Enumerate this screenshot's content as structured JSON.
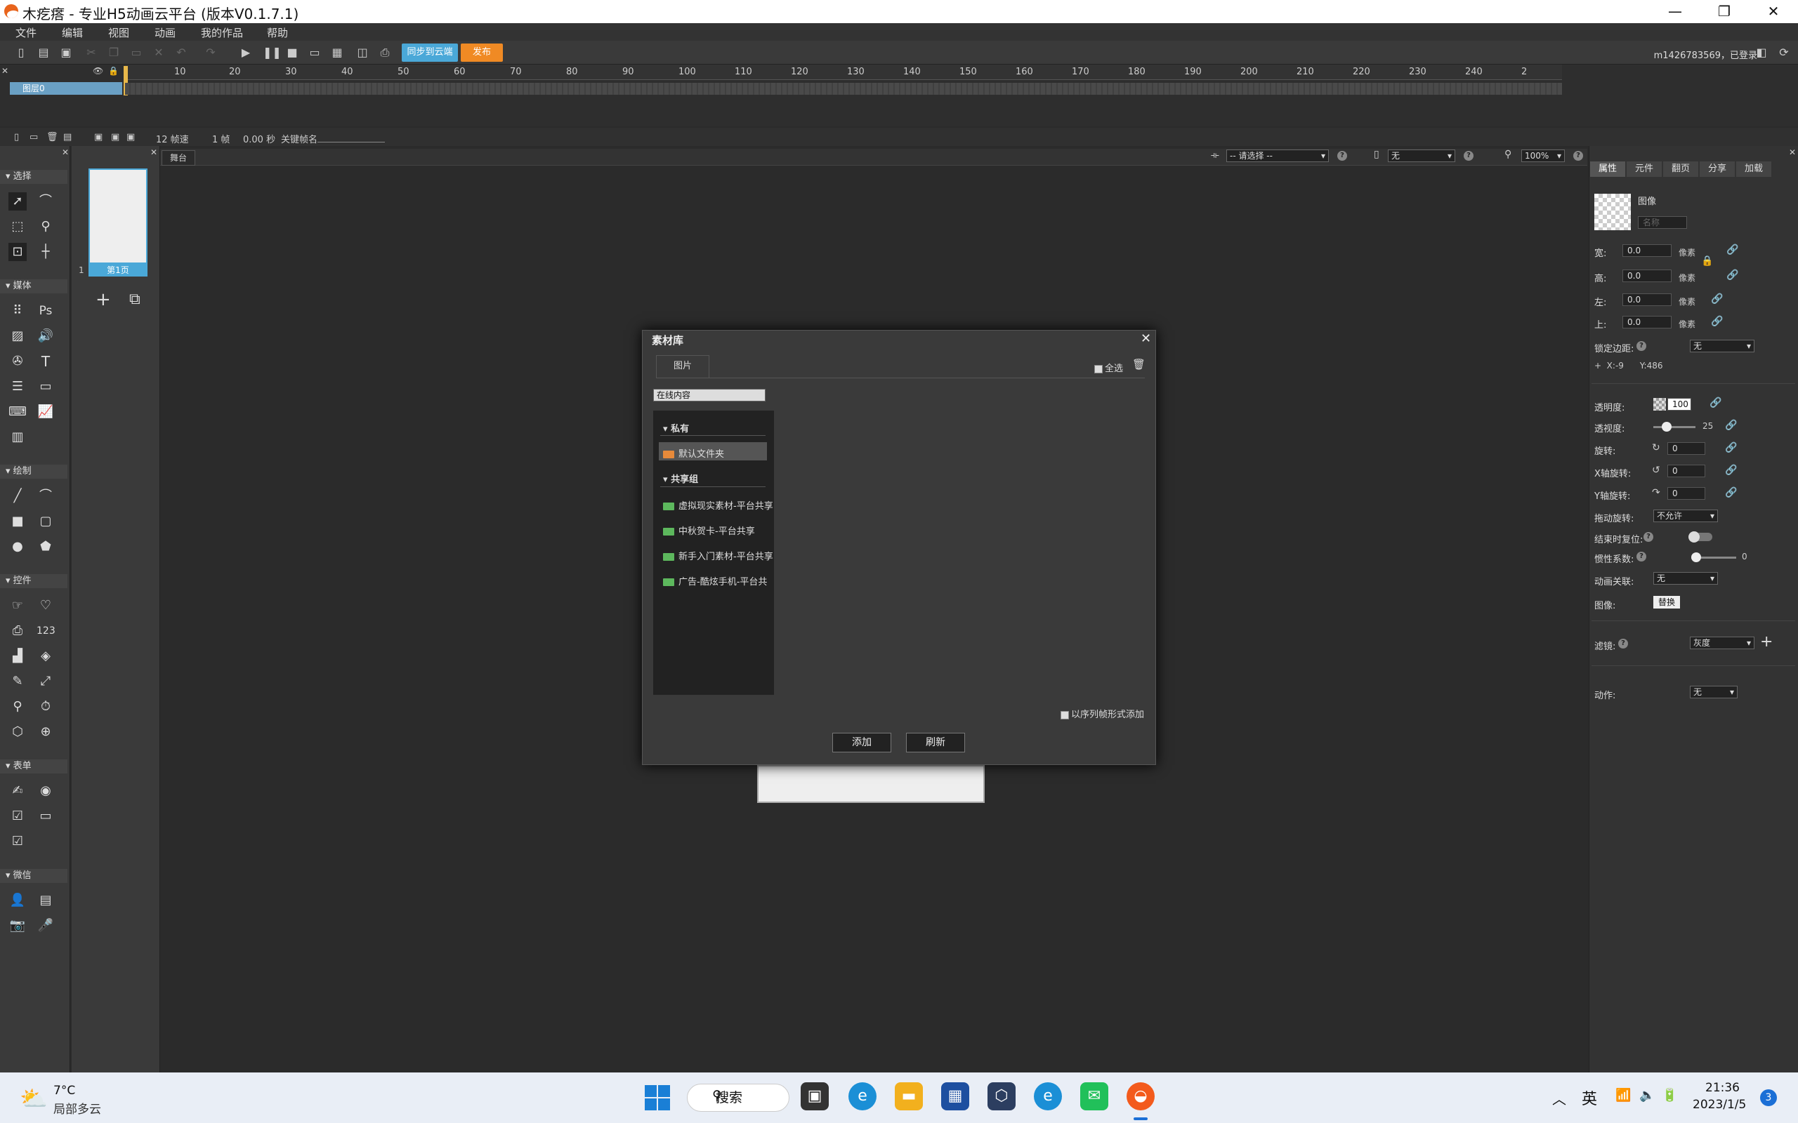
{
  "window": {
    "title": "木疙瘩 - 专业H5动画云平台 (版本V0.1.7.1)",
    "minimize": "—",
    "maximize": "❐",
    "close": "✕"
  },
  "menu": [
    "文件",
    "编辑",
    "视图",
    "动画",
    "我的作品",
    "帮助"
  ],
  "toolbar": {
    "sync_label": "同步到云端",
    "publish_label": "发布",
    "user": "m1426783569，已登录"
  },
  "timeline": {
    "ruler": [
      "10",
      "20",
      "30",
      "40",
      "50",
      "60",
      "70",
      "80",
      "90",
      "100",
      "110",
      "120",
      "130",
      "140",
      "150",
      "160",
      "170",
      "180",
      "190",
      "200",
      "210",
      "220",
      "230",
      "240",
      "2"
    ],
    "layer_name": "图层0",
    "fps": "12 帧速",
    "frame": "1 帧",
    "seconds": "0.00 秒",
    "keyframe_label": "关键帧名"
  },
  "tools": {
    "sections": [
      "选择",
      "媒体",
      "绘制",
      "控件",
      "表单",
      "微信"
    ],
    "media_ps": "Ps",
    "text_t": "T",
    "counter_123": "123"
  },
  "pages": {
    "number": "1",
    "label": "第1页"
  },
  "stage": {
    "tab": "舞台",
    "select_placeholder": "-- 请选择 --",
    "device_value": "无",
    "zoom": "100%"
  },
  "props": {
    "tabs": [
      "属性",
      "元件",
      "翻页",
      "分享",
      "加载"
    ],
    "type": "图像",
    "name_placeholder": "名称",
    "rows": [
      {
        "label": "宽:",
        "value": "0.0",
        "unit": "像素"
      },
      {
        "label": "高:",
        "value": "0.0",
        "unit": "像素"
      },
      {
        "label": "左:",
        "value": "0.0",
        "unit": "像素"
      },
      {
        "label": "上:",
        "value": "0.0",
        "unit": "像素"
      }
    ],
    "lock_margin_label": "锁定边距:",
    "lock_margin_value": "无",
    "coords": "+  X:-9      Y:486",
    "opacity_label": "透明度:",
    "opacity_value": "100",
    "perspective_label": "透视度:",
    "perspective_value": "25",
    "rotation_label": "旋转:",
    "rotation_value": "0",
    "xrot_label": "X轴旋转:",
    "xrot_value": "0",
    "yrot_label": "Y轴旋转:",
    "yrot_value": "0",
    "drag_rotate_label": "拖动旋转:",
    "drag_rotate_value": "不允许",
    "reset_label": "结束时复位:",
    "inertia_label": "惯性系数:",
    "inertia_value": "0",
    "anim_link_label": "动画关联:",
    "anim_link_value": "无",
    "image_label": "图像:",
    "replace_label": "替换",
    "filter_label": "滤镜:",
    "filter_value": "灰度",
    "action_label": "动作:",
    "action_value": "无"
  },
  "dialog": {
    "title": "素材库",
    "tab": "图片",
    "select_all": "全选",
    "source": "在线内容",
    "private_header": "私有",
    "default_folder": "默认文件夹",
    "shared_header": "共享组",
    "shared_items": [
      "虚拟现实素材-平台共享",
      "中秋贺卡-平台共享",
      "新手入门素材-平台共享",
      "广告-酷炫手机-平台共"
    ],
    "sequence_label": "以序列帧形式添加",
    "add_label": "添加",
    "refresh_label": "刷新"
  },
  "taskbar": {
    "temp": "7°C",
    "weather": "局部多云",
    "search": "搜索",
    "ime": "英",
    "time": "21:36",
    "date": "2023/1/5",
    "notif": "3"
  }
}
